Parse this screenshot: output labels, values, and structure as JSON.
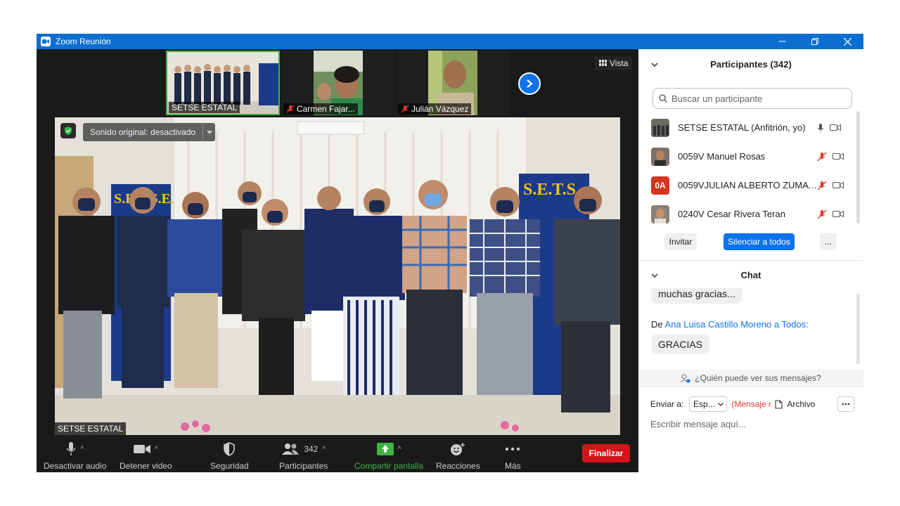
{
  "titlebar": {
    "title": "Zoom Reunión"
  },
  "gallery": {
    "tiles": [
      {
        "name": "SETSE ESTATAL",
        "muted": false
      },
      {
        "name": "Carmen Fajar...",
        "muted": true
      },
      {
        "name": "Julián Vázquez",
        "muted": true
      }
    ],
    "view_label": "Vista"
  },
  "main_video": {
    "sound_label": "Sonido original: desactivado",
    "speaker_name": "SETSE ESTATAL",
    "banner_text_left": "S.E.T.S.E.",
    "banner_text_right": "S.E.T.S."
  },
  "toolbar": {
    "audio": "Desactivar audio",
    "video": "Detener video",
    "security": "Seguridad",
    "participants": "Participantes",
    "participants_count": "342",
    "share": "Compartir pantalla",
    "reactions": "Reacciones",
    "more": "Más",
    "end": "Finalizar"
  },
  "participants_panel": {
    "title": "Participantes (342)",
    "search_placeholder": "Buscar un participante",
    "rows": [
      {
        "name": "SETSE ESTATAL (Anfitrión, yo)",
        "muted": false,
        "avatar": ""
      },
      {
        "name": "0059V Manuel Rosas",
        "muted": true,
        "avatar": ""
      },
      {
        "name": "0059VJULIAN ALBERTO ZUMAYA...",
        "muted": true,
        "avatar": "0A"
      },
      {
        "name": "0240V Cesar Rivera Teran",
        "muted": true,
        "avatar": ""
      }
    ],
    "invite": "Invitar",
    "mute_all": "Silenciar a todos",
    "more": "..."
  },
  "chat_panel": {
    "title": "Chat",
    "messages": [
      {
        "text": "muchas gracias..."
      },
      {
        "prefix": "De",
        "sender": "Ana Luisa Castillo Moreno",
        "to": "a Todos:",
        "text": "GRACIAS"
      }
    ],
    "who_can_see": "¿Quién puede ver sus mensajes?",
    "send_to_label": "Enviar a:",
    "send_to_value": "Esp...",
    "private_note": "(Mensaje c",
    "file_label": "Archivo",
    "compose_placeholder": "Escribir mensaje aquí..."
  },
  "colors": {
    "zoom_blue": "#0e72ed",
    "titlebar_blue": "#0b6fd1",
    "end_red": "#d0161b",
    "share_green": "#3fb33f",
    "mute_red": "#e0392b"
  }
}
